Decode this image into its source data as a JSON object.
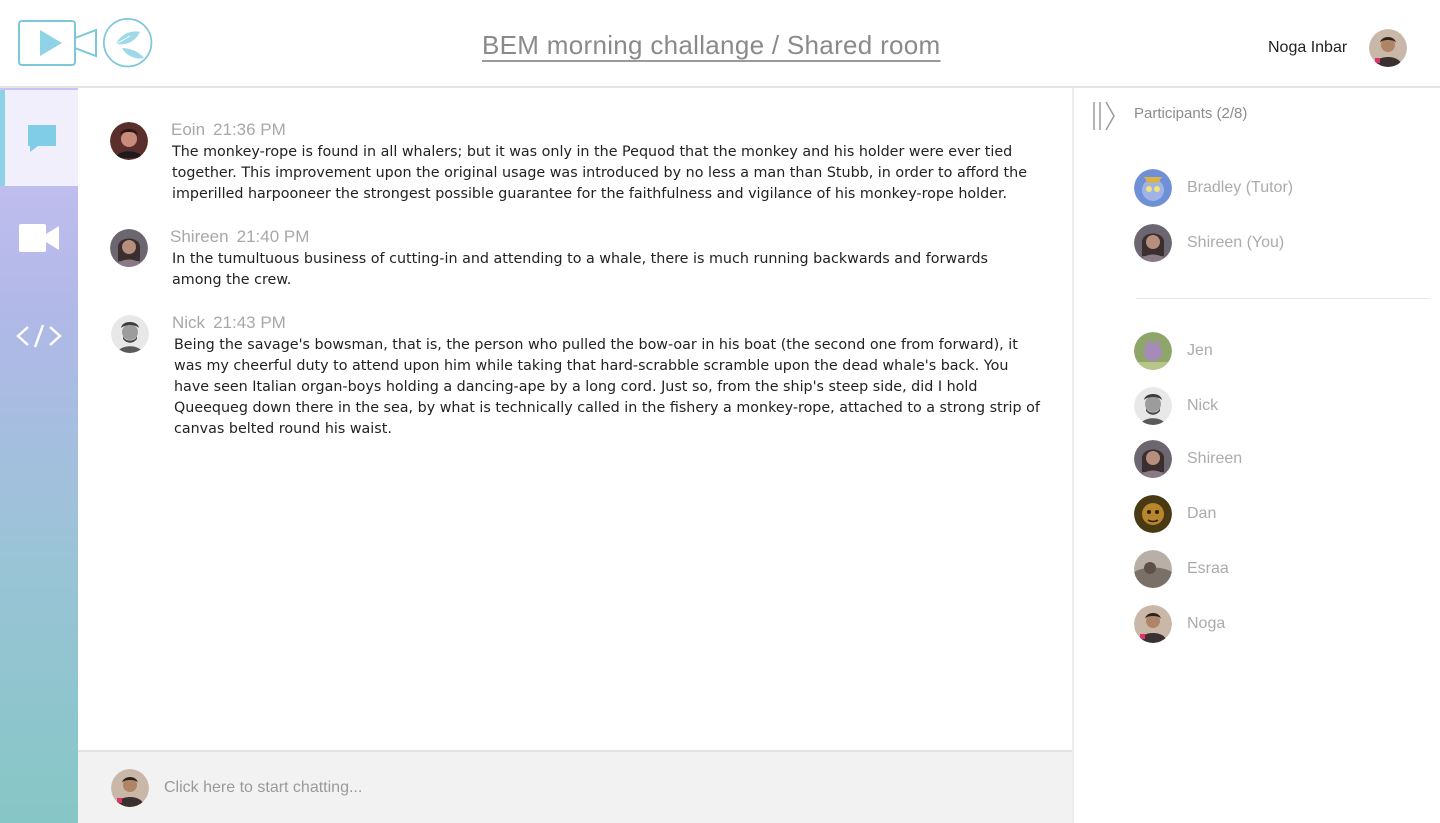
{
  "header": {
    "room_title": "BEM morning challange / Shared room",
    "user_name": "Noga Inbar"
  },
  "sidebar": {
    "items": [
      {
        "name": "chat",
        "icon": "chat-bubble-icon",
        "active": true
      },
      {
        "name": "video",
        "icon": "video-camera-icon",
        "active": false
      },
      {
        "name": "code",
        "icon": "code-icon",
        "active": false
      }
    ]
  },
  "messages": [
    {
      "author": "Eoin",
      "time": "21:36 PM",
      "text": "The monkey-rope is found in all whalers; but it was only in the Pequod that the monkey and his holder were ever tied together. This improvement upon the original usage was introduced by no less a man than Stubb, in order to afford the imperilled harpooneer the strongest possible guarantee for the faithfulness and vigilance of his monkey-rope holder."
    },
    {
      "author": "Shireen",
      "time": "21:40 PM",
      "text": "In the tumultuous business of cutting-in and attending to a whale, there is much running backwards and forwards among the crew."
    },
    {
      "author": "Nick",
      "time": "21:43 PM",
      "text": "Being the savage's bowsman, that is, the person who pulled the bow-oar in his boat (the second one from forward), it was my cheerful duty to attend upon him while taking that hard-scrabble scramble upon the dead whale's back. You have seen Italian organ-boys holding a dancing-ape by a long cord. Just so, from the ship's steep side, did I hold Queequeg down there in the sea, by what is technically called in the fishery a monkey-rope, attached to a strong strip of canvas belted round his waist."
    }
  ],
  "composer": {
    "placeholder": "Click here to start chatting..."
  },
  "participants": {
    "title": "Participants (2/8)",
    "online": [
      {
        "name": "Bradley (Tutor)"
      },
      {
        "name": "Shireen (You)"
      }
    ],
    "offline": [
      {
        "name": "Jen"
      },
      {
        "name": "Nick"
      },
      {
        "name": "Shireen"
      },
      {
        "name": "Dan"
      },
      {
        "name": "Esraa"
      },
      {
        "name": "Noga"
      }
    ]
  },
  "colors": {
    "accent": "#8fd1e8",
    "sidebar_top": "#c9c2f2",
    "sidebar_bottom": "#86c6c6"
  }
}
